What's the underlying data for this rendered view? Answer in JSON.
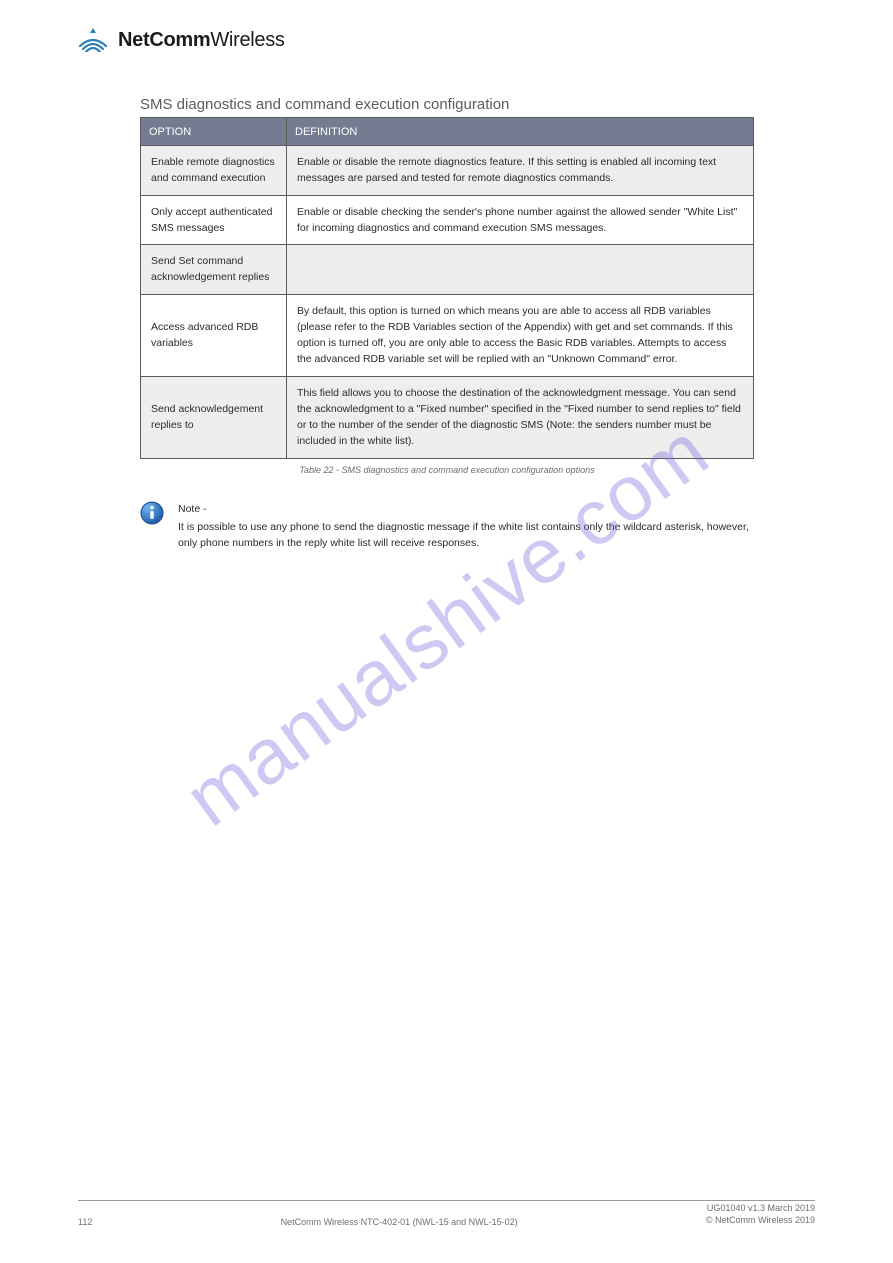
{
  "brand": {
    "bold": "NetComm",
    "thin": "Wireless"
  },
  "section_title": "SMS diagnostics and command execution configuration",
  "table": {
    "headers": {
      "option": "OPTION",
      "definition": "DEFINITION"
    },
    "rows": [
      {
        "opt": "Enable remote diagnostics and command execution",
        "def": "Enable or disable the remote diagnostics feature. If this setting is enabled all incoming text messages are parsed and tested for remote diagnostics commands.",
        "shade": true
      },
      {
        "opt": "Only accept authenticated SMS messages",
        "def": "Enable or disable checking the sender's phone number against the allowed sender \"White List\" for incoming diagnostics and command execution SMS messages.",
        "shade": false
      },
      {
        "opt": "Send Set command acknowledgement replies",
        "def": "",
        "shade": true
      },
      {
        "opt": "Access advanced RDB variables",
        "def": "By default, this option is turned on which means you are able to access all RDB variables (please refer to the RDB Variables section of the Appendix) with get and set commands. If this option is turned off, you are only able to access the Basic RDB variables. Attempts to access the advanced RDB variable set will be replied with an \"Unknown Command\" error.",
        "shade": false
      },
      {
        "opt": "Send acknowledgement replies to",
        "def": "This field allows you to choose the destination of the acknowledgment message. You can send the acknowledgment to a \"Fixed number\" specified in the \"Fixed number to send replies to\" field or to the number of the sender of the diagnostic SMS (Note: the senders number must be included in the white list).",
        "shade": true
      }
    ]
  },
  "caption": "Table 22 - SMS diagnostics and command execution configuration options",
  "note": {
    "label": "Note -",
    "body": "It is possible to use any phone to send the diagnostic message if the white list contains only the wildcard asterisk, however, only phone numbers in the reply white list will receive responses."
  },
  "watermark": "manualshive.com",
  "footer": {
    "page": "112",
    "center": "NetComm Wireless NTC-402-01 (NWL-15 and NWL-15-02)",
    "right_l1": "UG01040 v1.3 March 2019",
    "right_l2": "© NetComm Wireless 2019"
  }
}
